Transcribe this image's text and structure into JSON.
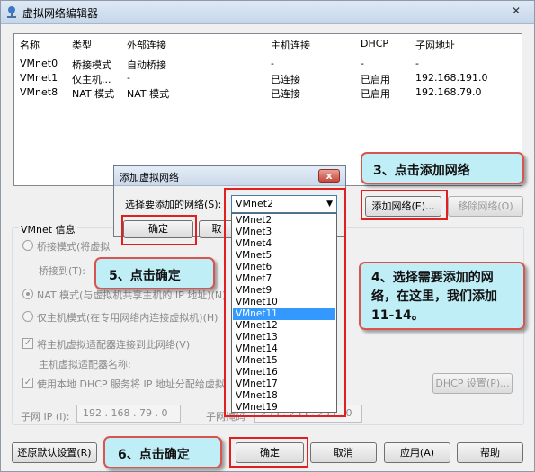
{
  "window": {
    "title": "虚拟网络编辑器",
    "close_glyph": "✕"
  },
  "list": {
    "headers": [
      "名称",
      "类型",
      "外部连接",
      "主机连接",
      "DHCP",
      "子网地址"
    ],
    "rows": [
      [
        "VMnet0",
        "桥接模式",
        "自动桥接",
        "-",
        "-",
        "-"
      ],
      [
        "VMnet1",
        "仅主机...",
        "-",
        "已连接",
        "已启用",
        "192.168.191.0"
      ],
      [
        "VMnet8",
        "NAT 模式",
        "NAT 模式",
        "已连接",
        "已启用",
        "192.168.79.0"
      ]
    ]
  },
  "buttons": {
    "add_network": "添加网络(E)...",
    "remove_network": "移除网络(O)",
    "restore_defaults": "还原默认设置(R)",
    "ok": "确定",
    "cancel": "取消",
    "apply": "应用(A)",
    "help": "帮助",
    "dhcp_settings": "DHCP 设置(P)..."
  },
  "vmnet_info": {
    "group_label": "VMnet 信息",
    "bridged_radio": "桥接模式(将虚拟",
    "bridged_to_label": "桥接到(T):",
    "nat_radio": "NAT 模式(与虚拟机共享主机的 IP 地址)(N)",
    "hostonly_radio": "仅主机模式(在专用网络内连接虚拟机)(H)",
    "connect_adapter_cb": "将主机虚拟适配器连接到此网络(V)",
    "adapter_name_label": "主机虚拟适配器名称:",
    "use_dhcp_cb": "使用本地 DHCP 服务将 IP 地址分配给虚拟",
    "subnet_ip_label": "子网 IP (I):",
    "subnet_ip_value": "192 . 168 . 79 . 0",
    "subnet_mask_label": "子网掩码",
    "subnet_mask_value": "255 . 255 . 255 . 0"
  },
  "add_dialog": {
    "title": "添加虚拟网络",
    "prompt": "选择要添加的网络(S):",
    "selected": "VMnet2",
    "ok": "确定",
    "cancel": "取",
    "close_glyph": "x"
  },
  "dropdown": {
    "items": [
      "VMnet2",
      "VMnet3",
      "VMnet4",
      "VMnet5",
      "VMnet6",
      "VMnet7",
      "VMnet9",
      "VMnet10",
      "VMnet11",
      "VMnet12",
      "VMnet13",
      "VMnet14",
      "VMnet15",
      "VMnet16",
      "VMnet17",
      "VMnet18",
      "VMnet19"
    ],
    "highlighted": "VMnet11"
  },
  "callouts": {
    "step3": "3、点击添加网络",
    "step4": "4、选择需要添加的网络，在这里，我们添加11-14。",
    "step5": "5、点击确定",
    "step6": "6、点击确定"
  },
  "colors": {
    "callout_bg": "#bfeef7",
    "callout_border": "#d9534f",
    "highlight": "#3399ff",
    "redbox": "#e02020"
  }
}
